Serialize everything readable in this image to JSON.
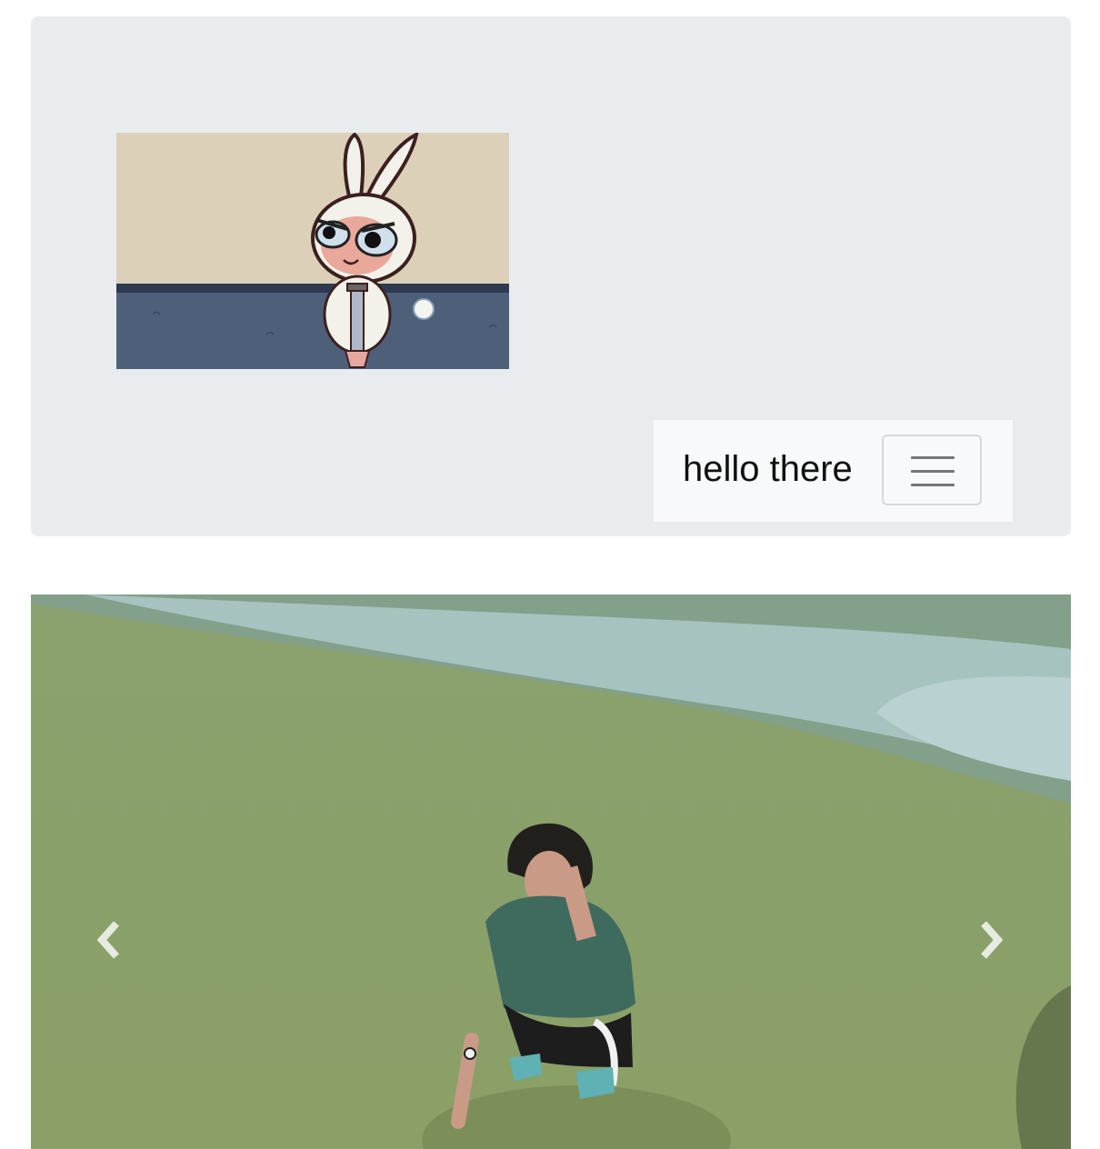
{
  "navbar": {
    "brand": "hello there",
    "toggler_icon": "hamburger-menu-icon"
  },
  "jumbotron": {
    "image_subject": "cartoon"
  },
  "carousel": {
    "prev_icon": "chevron-left-icon",
    "next_icon": "chevron-right-icon"
  },
  "colors": {
    "jumbotron_bg": "#e9ecef",
    "navbar_bg": "#f8f9fa"
  }
}
